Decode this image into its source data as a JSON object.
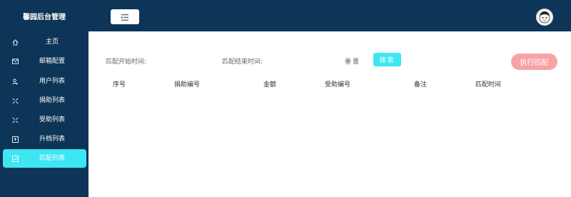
{
  "header": {
    "app_title": "馨园后台管理"
  },
  "sidebar": {
    "items": [
      {
        "label": "主页",
        "icon": "home-icon"
      },
      {
        "label": "邮箱配置",
        "icon": "mail-icon"
      },
      {
        "label": "用户列表",
        "icon": "users-icon"
      },
      {
        "label": "捐助列表",
        "icon": "expand-icon"
      },
      {
        "label": "受助列表",
        "icon": "expand-icon"
      },
      {
        "label": "升档列表",
        "icon": "upgrade-icon"
      },
      {
        "label": "匹配列表",
        "icon": "chart-icon",
        "active": true
      }
    ]
  },
  "filters": {
    "start_label": "匹配开始时间:",
    "end_label": "匹配结束时间:",
    "reset_label": "重置",
    "search_label": "搜索",
    "match_label": "执行匹配"
  },
  "table": {
    "columns": [
      "序号",
      "捐助编号",
      "金额",
      "受助编号",
      "备注",
      "匹配时间"
    ],
    "rows": []
  },
  "colors": {
    "nav_bg": "#0c3557",
    "accent": "#3ee6f2",
    "match_button": "#f7a3a6"
  }
}
